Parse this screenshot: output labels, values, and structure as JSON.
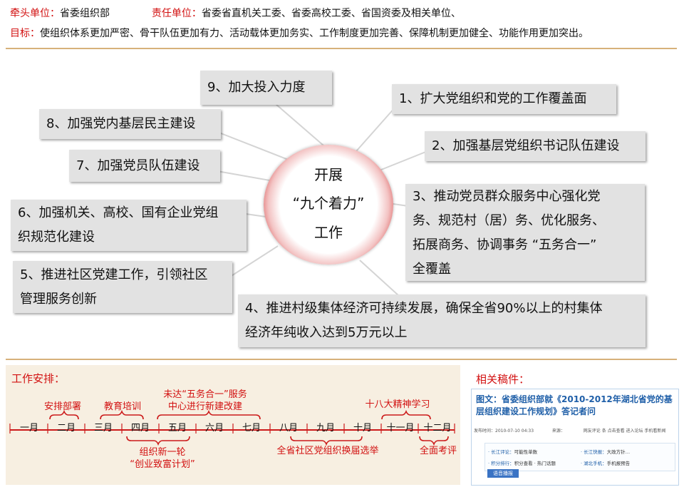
{
  "header": {
    "lead_label": "牵头单位：",
    "lead_value": "省委组织部",
    "resp_label": "责任单位：",
    "resp_value": "省委省直机关工委、省委高校工委、省国资委及相关单位、",
    "goal_label": "目标：",
    "goal_value": "使组织体系更加严密、骨干队伍更加有力、活动载体更加务实、工作制度更加完善、保障机制更加健全、功能作用更加突出。"
  },
  "center": {
    "line1": "开展",
    "line2": "“九个着力”",
    "line3": "工作"
  },
  "items": {
    "i1": "1、扩大党组织和党的工作覆盖面",
    "i2": "2、加强基层党组织书记队伍建设",
    "i3": [
      "3、推动党员群众服务中心强化党",
      "务、规范村（居）务、优化服务、",
      "拓展商务、协调事务 “五务合一”",
      "全覆盖"
    ],
    "i4": [
      "4、推进村级集体经济可持续发展，确保全省90%以上的村集体",
      "经济年纯收入达到5万元以上"
    ],
    "i5": [
      "5、推进社区党建工作，引领社区",
      "管理服务创新"
    ],
    "i6": [
      "6、加强机关、高校、国有企业党组",
      "织规范化建设"
    ],
    "i7": "7、加强党员队伍建设",
    "i8": "8、加强党内基层民主建设",
    "i9": "9、加大投入力度"
  },
  "schedule": {
    "title": "工作安排：",
    "months": [
      "一月",
      "二月",
      "三月",
      "四月",
      "五月",
      "六月",
      "七月",
      "八月",
      "九月",
      "十月",
      "十一月",
      "十二月"
    ],
    "above": {
      "a1": "安排部署",
      "a2": "教育培训",
      "a3": [
        "未达“五务合一”服务",
        "中心进行新建改建"
      ],
      "a4": "十八大精神学习"
    },
    "below": {
      "b1": [
        "组织新一轮",
        "“创业致富计划”"
      ],
      "b2": "全省社区党组织换届选举",
      "b3": "全面考评"
    }
  },
  "related": {
    "title": "相关稿件：",
    "article_title": "图文：省委组织部就《2010-2012年湖北省党的基层组织建设工作规划》答记者问",
    "meta_left": "发布时间：2010-07-10 04:33",
    "meta_mid": "来源：",
    "meta_right": "网友评论  条  点击查看  进入论坛  手机看新闻",
    "links": [
      [
        "· 长江评论：",
        "可能性单数",
        "· 长江快报：",
        "大政方针…"
      ],
      [
        "· 积分排行：",
        "积分查看 · 热门话题",
        "· 湖北手机：",
        "手机报预告"
      ]
    ],
    "button": "语音播报"
  },
  "colors": {
    "accent_red": "#d21010",
    "box_gray": "#e2e2e2",
    "divider_tan": "#d7b17a",
    "schedule_bg": "#f7efe1"
  }
}
